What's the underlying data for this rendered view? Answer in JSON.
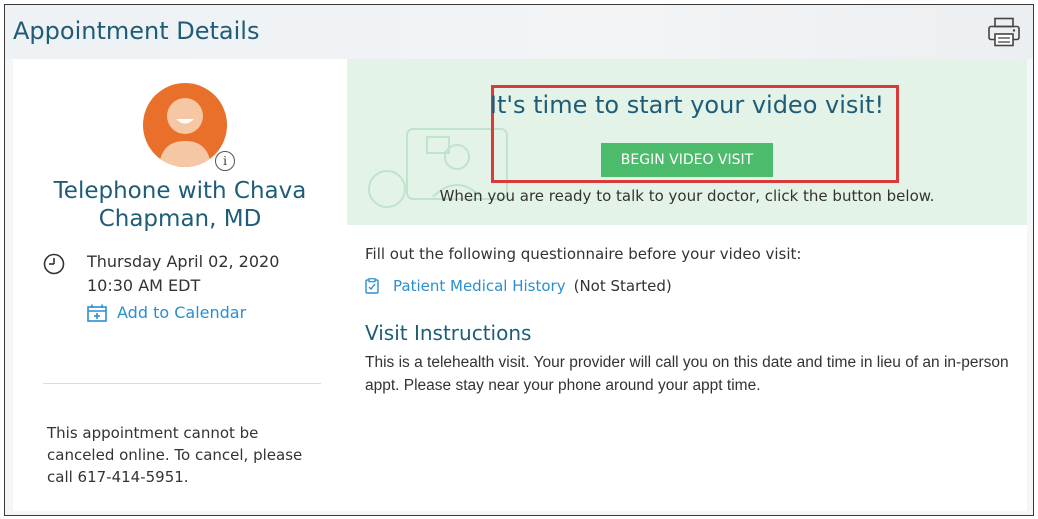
{
  "header": {
    "title": "Appointment Details",
    "print_icon": "printer-icon"
  },
  "provider": {
    "name": "Telephone with Chava Chapman, MD",
    "avatar_color": "#e8702a",
    "info_symbol": "i"
  },
  "appointment": {
    "date": "Thursday April 02, 2020",
    "time": "10:30 AM EDT",
    "add_to_calendar": "Add to Calendar",
    "cancel_note": "This appointment cannot be canceled online. To cancel, please call 617-414-5951."
  },
  "video_banner": {
    "heading": "It's time to start your video visit!",
    "button_label": "BEGIN VIDEO VISIT",
    "subtext": "When you are ready to talk to your doctor, click the button below.",
    "background_color": "#e4f3e8",
    "button_color": "#4cbb6c",
    "highlight_color": "#d93b3b"
  },
  "questionnaire": {
    "intro": "Fill out the following questionnaire before your video visit:",
    "items": [
      {
        "label": "Patient Medical History",
        "status": "(Not Started)"
      }
    ]
  },
  "instructions": {
    "heading": "Visit Instructions",
    "text": "This is a telehealth visit. Your provider will call you on this date and time in lieu of an in-person appt. Please stay near your phone around your appt time."
  },
  "colors": {
    "heading": "#1f5c78",
    "link": "#2b8fcf"
  }
}
